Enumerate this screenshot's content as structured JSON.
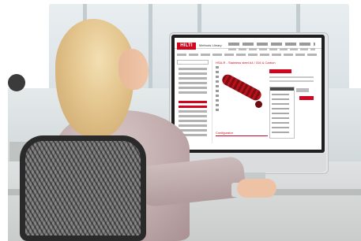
{
  "screen_app": {
    "brand_logo_text": "HILTI",
    "brand_color": "#d2051e",
    "app_title": "Methods Library",
    "content_title": "HSA-R - Stainless steel A4 / 316 & Carbon",
    "configurator_label": "Configurator"
  },
  "colors": {
    "monitor_frame": "#e3e5e6",
    "bezel": "#1f1f1f",
    "hair": "#e3c48c",
    "sweater": "#bfa9aa",
    "chair_mesh": "#6f6f6f"
  }
}
